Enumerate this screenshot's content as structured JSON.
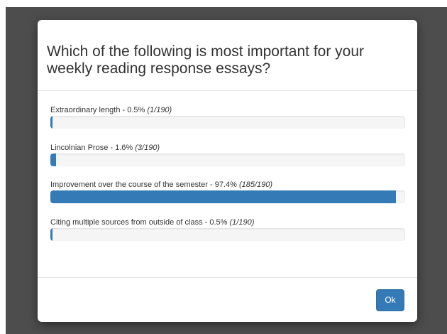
{
  "modal": {
    "title": "Which of the following is most important for your weekly reading response essays?",
    "ok_label": "Ok"
  },
  "accent_color": "#337ab7",
  "results": [
    {
      "text": "Extraordinary length - 0.5% ",
      "count": "(1/190)",
      "percent": 0.5
    },
    {
      "text": "Lincolnian Prose - 1.6% ",
      "count": "(3/190)",
      "percent": 1.6
    },
    {
      "text": "Improvement over the course of the semester - 97.4% ",
      "count": "(185/190)",
      "percent": 97.4
    },
    {
      "text": "Citing multiple sources from outside of class - 0.5% ",
      "count": "(1/190)",
      "percent": 0.5
    }
  ]
}
